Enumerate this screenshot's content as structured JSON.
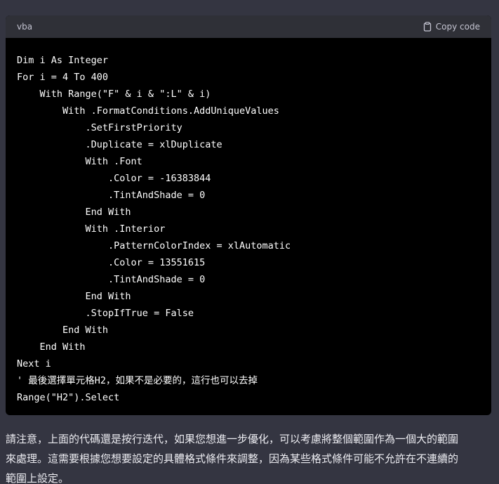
{
  "code_block": {
    "language": "vba",
    "copy_label": "Copy code",
    "copy_icon": "clipboard-icon",
    "lines": [
      "Dim i As Integer",
      "For i = 4 To 400",
      "    With Range(\"F\" & i & \":L\" & i)",
      "        With .FormatConditions.AddUniqueValues",
      "            .SetFirstPriority",
      "            .Duplicate = xlDuplicate",
      "            With .Font",
      "                .Color = -16383844",
      "                .TintAndShade = 0",
      "            End With",
      "            With .Interior",
      "                .PatternColorIndex = xlAutomatic",
      "                .Color = 13551615",
      "                .TintAndShade = 0",
      "            End With",
      "            .StopIfTrue = False",
      "        End With",
      "    End With",
      "Next i",
      "' 最後選擇單元格H2，如果不是必要的，這行也可以去掉",
      "Range(\"H2\").Select"
    ]
  },
  "paragraph": {
    "lines": [
      "請注意，上面的代碼還是按行迭代，如果您想進一步優化，可以考慮將整個範圍作為一個大的範圍",
      "來處理。這需要根據您想要設定的具體格式條件來調整，因為某些格式條件可能不允許在不連續的",
      "範圍上設定。"
    ]
  },
  "colors": {
    "page_background": "#343541",
    "code_background": "#000000",
    "code_header_background": "#2f3037",
    "code_text": "#ffffff",
    "body_text": "#ececf1"
  }
}
